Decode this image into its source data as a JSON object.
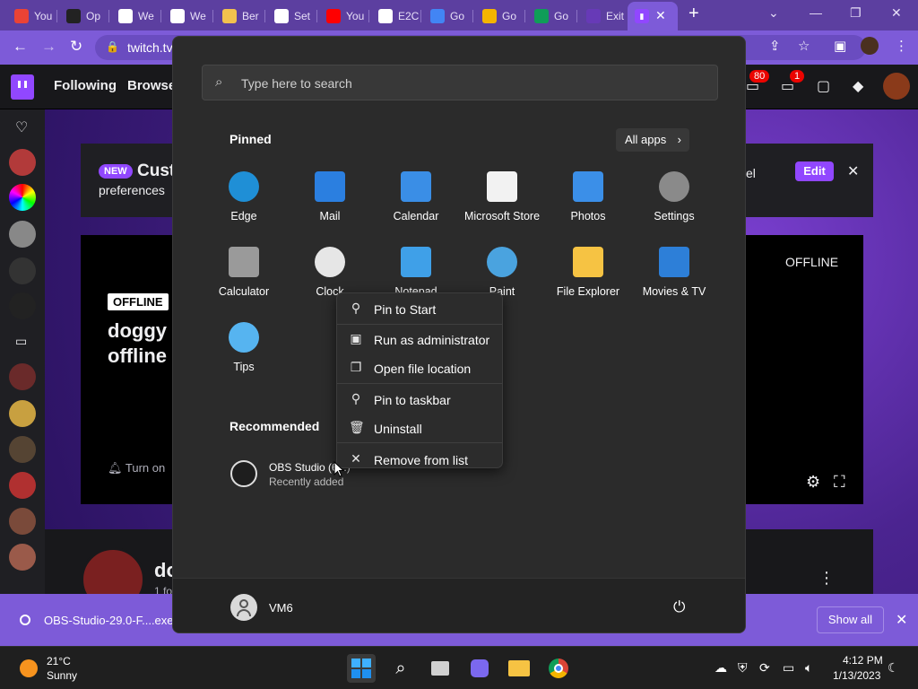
{
  "browser": {
    "tabs": [
      {
        "label": "You",
        "icon": "gmail-icon",
        "color": "#ea4335"
      },
      {
        "label": "Op",
        "icon": "obs-icon",
        "color": "#222222"
      },
      {
        "label": "We",
        "icon": "globe-icon",
        "color": "#ffffff"
      },
      {
        "label": "We",
        "icon": "globe-icon",
        "color": "#ffffff"
      },
      {
        "label": "Ber",
        "icon": "coin-icon",
        "color": "#f2c14e"
      },
      {
        "label": "Set",
        "icon": "gear-icon",
        "color": "#ffffff"
      },
      {
        "label": "You",
        "icon": "youtube-icon",
        "color": "#ff0000"
      },
      {
        "label": "E2C",
        "icon": "globe-icon",
        "color": "#ffffff"
      },
      {
        "label": "Go",
        "icon": "docs-icon",
        "color": "#4285f4"
      },
      {
        "label": "Go",
        "icon": "slides-icon",
        "color": "#f4b400"
      },
      {
        "label": "Go",
        "icon": "sheets-icon",
        "color": "#0f9d58"
      },
      {
        "label": "Exit",
        "icon": "forms-icon",
        "color": "#673ab7"
      }
    ],
    "active_tab_icon": "twitch-icon",
    "url": "twitch.tv"
  },
  "twitch": {
    "nav": {
      "following": "Following",
      "browse": "Browse"
    },
    "notifications_count": "80",
    "inbox_count": "1",
    "banner": {
      "new_badge": "NEW",
      "title": "Cust",
      "subtitle": "preferences",
      "right_fragment": "el",
      "edit_label": "Edit"
    },
    "player": {
      "offline_tag": "OFFLINE",
      "offline_right": "OFFLINE",
      "headline": "doggy\noffline",
      "notify": "Turn on"
    },
    "channel": {
      "name": "do",
      "followers": "1 fo"
    }
  },
  "download_bar": {
    "file_name": "OBS-Studio-29.0-F....exe",
    "show_all": "Show all"
  },
  "start_menu": {
    "search_placeholder": "Type here to search",
    "pinned_heading": "Pinned",
    "all_apps_label": "All apps",
    "pinned": [
      {
        "label": "Edge",
        "icon": "edge-icon",
        "color": "#1f8fd6"
      },
      {
        "label": "Mail",
        "icon": "mail-icon",
        "color": "#2b7fe0"
      },
      {
        "label": "Calendar",
        "icon": "calendar-icon",
        "color": "#3a8ee6"
      },
      {
        "label": "Microsoft Store",
        "icon": "store-icon",
        "color": "#f2f2f2"
      },
      {
        "label": "Photos",
        "icon": "photos-icon",
        "color": "#3b8fe8"
      },
      {
        "label": "Settings",
        "icon": "settings-icon",
        "color": "#8a8a8a"
      },
      {
        "label": "Calculator",
        "icon": "calculator-icon",
        "color": "#9a9a9a"
      },
      {
        "label": "Clock",
        "icon": "clock-icon",
        "color": "#e6e6e6"
      },
      {
        "label": "Notepad",
        "icon": "notepad-icon",
        "color": "#3fa0e8"
      },
      {
        "label": "Paint",
        "icon": "paint-icon",
        "color": "#4aa3df"
      },
      {
        "label": "File Explorer",
        "icon": "folder-icon",
        "color": "#f6c343"
      },
      {
        "label": "Movies & TV",
        "icon": "movies-icon",
        "color": "#2d7fd8"
      },
      {
        "label": "Tips",
        "icon": "tips-icon",
        "color": "#56b4f0"
      }
    ],
    "recommended_heading": "Recommended",
    "recommended": [
      {
        "name": "OBS Studio (6...)",
        "subtitle": "Recently added"
      }
    ],
    "context_menu": [
      {
        "label": "Pin to Start",
        "icon": "pin-icon",
        "glyph": "⚲"
      },
      {
        "label": "Run as administrator",
        "icon": "shield-icon",
        "glyph": "▣"
      },
      {
        "label": "Open file location",
        "icon": "file-location-icon",
        "glyph": "❐"
      },
      {
        "label": "Pin to taskbar",
        "icon": "pin-icon",
        "glyph": "⚲"
      },
      {
        "label": "Uninstall",
        "icon": "trash-icon",
        "glyph": "🗑"
      },
      {
        "label": "Remove from list",
        "icon": "close-icon",
        "glyph": "✕"
      }
    ],
    "user_name": "VM6"
  },
  "taskbar": {
    "weather_temp": "21°C",
    "weather_condition": "Sunny",
    "time": "4:12 PM",
    "date": "1/13/2023"
  }
}
